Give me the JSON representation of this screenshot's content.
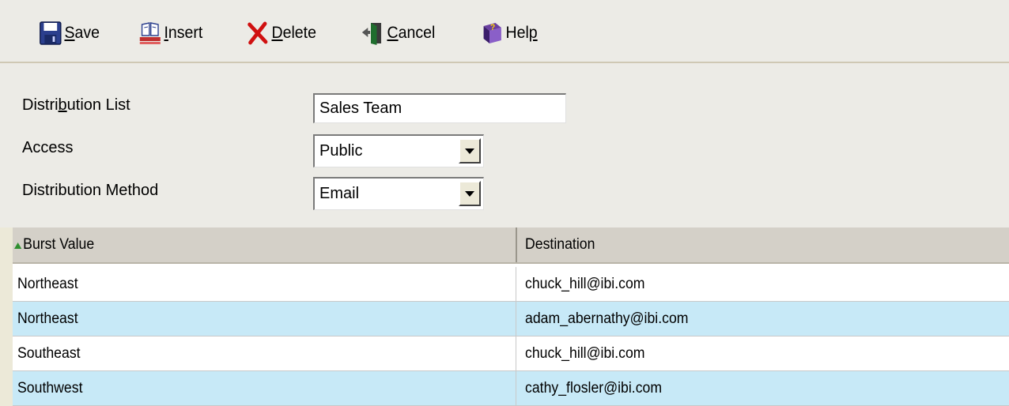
{
  "toolbar": {
    "save": {
      "prefix": "",
      "accel": "S",
      "rest": "ave",
      "icon": "floppy-disk-icon"
    },
    "insert": {
      "prefix": "",
      "accel": "I",
      "rest": "nsert",
      "icon": "insert-icon"
    },
    "delete": {
      "prefix": "",
      "accel": "D",
      "rest": "elete",
      "icon": "red-x-icon"
    },
    "cancel": {
      "prefix": "",
      "accel": "C",
      "rest": "ancel",
      "icon": "door-exit-icon"
    },
    "help": {
      "prefix": "Hel",
      "accel": "p",
      "rest": "",
      "icon": "help-book-icon"
    }
  },
  "form": {
    "distribution_list": {
      "prefix": "Distri",
      "accel": "b",
      "rest": "ution List",
      "value": "Sales Team"
    },
    "access": {
      "label": "Access",
      "value": "Public"
    },
    "distribution_method": {
      "label": "Distribution Method",
      "value": "Email"
    }
  },
  "grid": {
    "columns": [
      "Burst Value",
      "Destination"
    ],
    "rows": [
      {
        "burst": "Northeast",
        "destination": "chuck_hill@ibi.com"
      },
      {
        "burst": "Northeast",
        "destination": "adam_abernathy@ibi.com"
      },
      {
        "burst": "Southeast",
        "destination": "chuck_hill@ibi.com"
      },
      {
        "burst": "Southwest",
        "destination": "cathy_flosler@ibi.com"
      }
    ]
  },
  "colors": {
    "row_alt": "#c7e9f7",
    "header": "#d4d0c8",
    "background": "#ecebe6"
  }
}
